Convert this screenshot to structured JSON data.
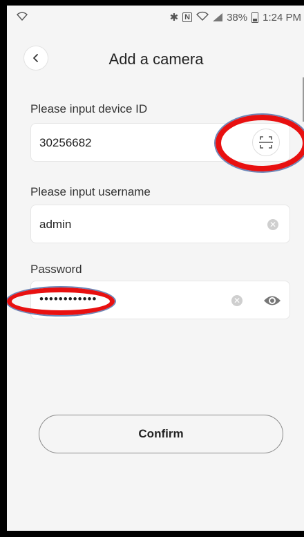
{
  "status_bar": {
    "battery": "38%",
    "time": "1:24 PM",
    "icons": [
      "wifi-icon",
      "bluetooth-icon",
      "nfc-icon",
      "wifi-calling-icon",
      "signal-icon",
      "battery-icon"
    ]
  },
  "header": {
    "title": "Add a camera",
    "back_icon": "chevron-left-icon"
  },
  "form": {
    "device_id_label": "Please input device ID",
    "device_id_value": "30256682",
    "username_label": "Please input username",
    "username_value": "admin",
    "password_label": "Password",
    "password_value": "••••••••••••"
  },
  "actions": {
    "confirm_label": "Confirm"
  },
  "colors": {
    "background": "#f5f5f5",
    "highlight": "#e81010",
    "highlight_outline": "#6b86b8"
  }
}
